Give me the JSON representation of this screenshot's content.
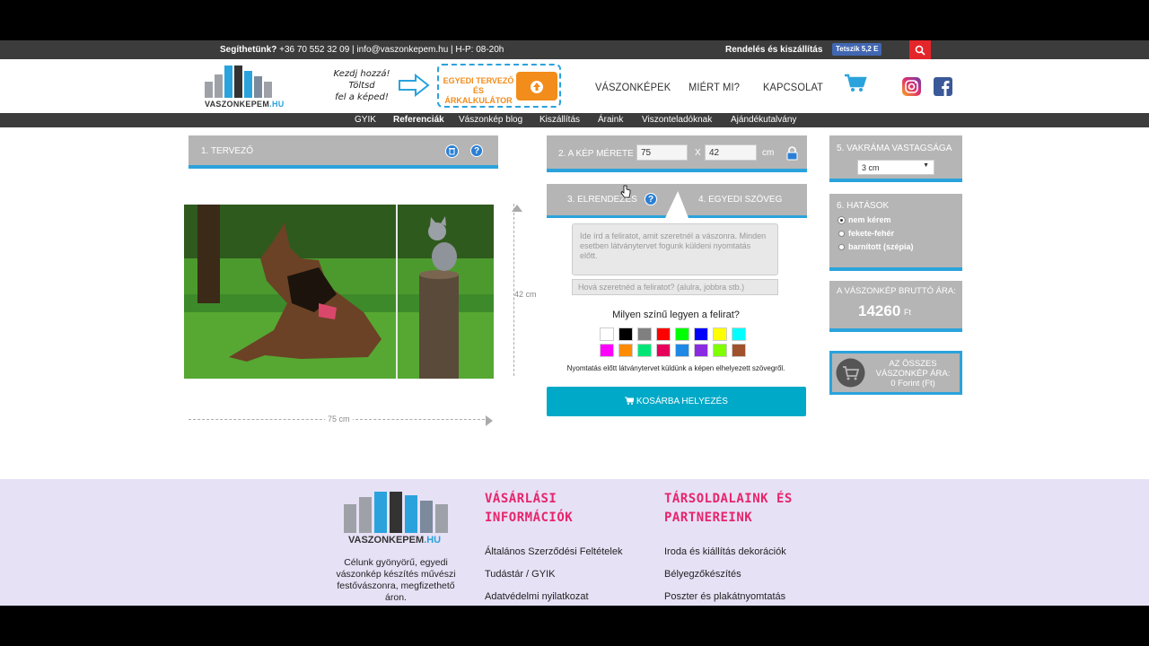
{
  "topbar": {
    "contact_bold": "Segíthetünk?",
    "contact_text": " +36 70 552 32 09 | info@vaszonkepem.hu | H-P: 08-20h",
    "order_link": "Rendelés és kiszállítás",
    "fb_like": "Tetszik 5,2 E"
  },
  "header": {
    "logo_main": "VASZONKEPEM",
    "logo_suffix": ".HU",
    "tagline_1": "Kezdj hozzá!",
    "tagline_2": "Töltsd",
    "tagline_3": "fel a képed!",
    "designer_label": "EGYEDI TERVEZŐ ÉS ÁRKALKULÁTOR",
    "nav": [
      "VÁSZONKÉPEK",
      "MIÉRT MI?",
      "KAPCSOLAT"
    ]
  },
  "subnav": [
    "GYIK",
    "Referenciák",
    "Vászonkép blog",
    "Kiszállítás",
    "Áraink",
    "Viszonteladóknak",
    "Ajándékutalvány"
  ],
  "designer": {
    "panel1_title": "1. TERVEZŐ",
    "width_dim": "75 cm",
    "height_dim": "42 cm"
  },
  "size": {
    "title": "2. A KÉP MÉRETE",
    "width": "75",
    "separator": "X",
    "height": "42",
    "unit": "cm"
  },
  "tabs": {
    "tab3": "3. ELRENDEZÉS",
    "tab4": "4. EGYEDI SZÖVEG"
  },
  "text_section": {
    "textarea_placeholder": "Ide írd a feliratot, amit szeretnél a vászonra. Minden esetben látványtervet fogunk küldeni nyomtatás előtt.",
    "placement_placeholder": "Hová szeretnéd a feliratot? (alulra, jobbra stb.)",
    "color_question": "Milyen színű legyen a felirat?",
    "note": "Nyomtatás előtt látványtervet küldünk a képen elhelyezett szövegről.",
    "cart_button": "KOSÁRBA HELYEZÉS",
    "swatch_colors": [
      "#ffffff",
      "#000000",
      "#808080",
      "#ff0000",
      "#00ff00",
      "#0000ff",
      "#ffff00",
      "#00ffff",
      "#ff00ff",
      "#ff8c00",
      "#00e676",
      "#e6005c",
      "#1e88e5",
      "#8a2be2",
      "#7fff00",
      "#a0522d"
    ]
  },
  "frame": {
    "title": "5. VAKRÁMA VASTAGSÁGA",
    "selected": "3 cm"
  },
  "effects": {
    "title": "6. HATÁSOK",
    "options": [
      "nem kérem",
      "fekete-fehér",
      "barnított (szépia)"
    ]
  },
  "price": {
    "title": "A VÁSZONKÉP BRUTTÓ ÁRA:",
    "value": "14260",
    "currency": "Ft"
  },
  "total": {
    "line1": "AZ ÖSSZES",
    "line2": "VÁSZONKÉP ÁRA:",
    "line3": "0 Forint (Ft)"
  },
  "footer": {
    "about": "Célunk gyönyörű, egyedi vászonkép készítés művészi festővászonra, megfizethető áron.",
    "col1_title_1": "VÁSÁRLÁSI",
    "col1_title_2": "INFORMÁCIÓK",
    "col1_links": [
      "Általános Szerződési Feltételek",
      "Tudástár / GYIK",
      "Adatvédelmi nyilatkozat"
    ],
    "col2_title_1": "TÁRSOLDALAINK ÉS",
    "col2_title_2": "PARTNEREINK",
    "col2_links": [
      "Iroda és kiállítás dekorációk",
      "Bélyegzőkészítés",
      "Poszter és plakátnyomtatás"
    ]
  },
  "colors": {
    "accent": "#2aa3dc",
    "panel": "#b5b5b5",
    "cart": "#00a9c7",
    "footer_title": "#e6256b",
    "footer_bg": "#e7e1f6"
  }
}
